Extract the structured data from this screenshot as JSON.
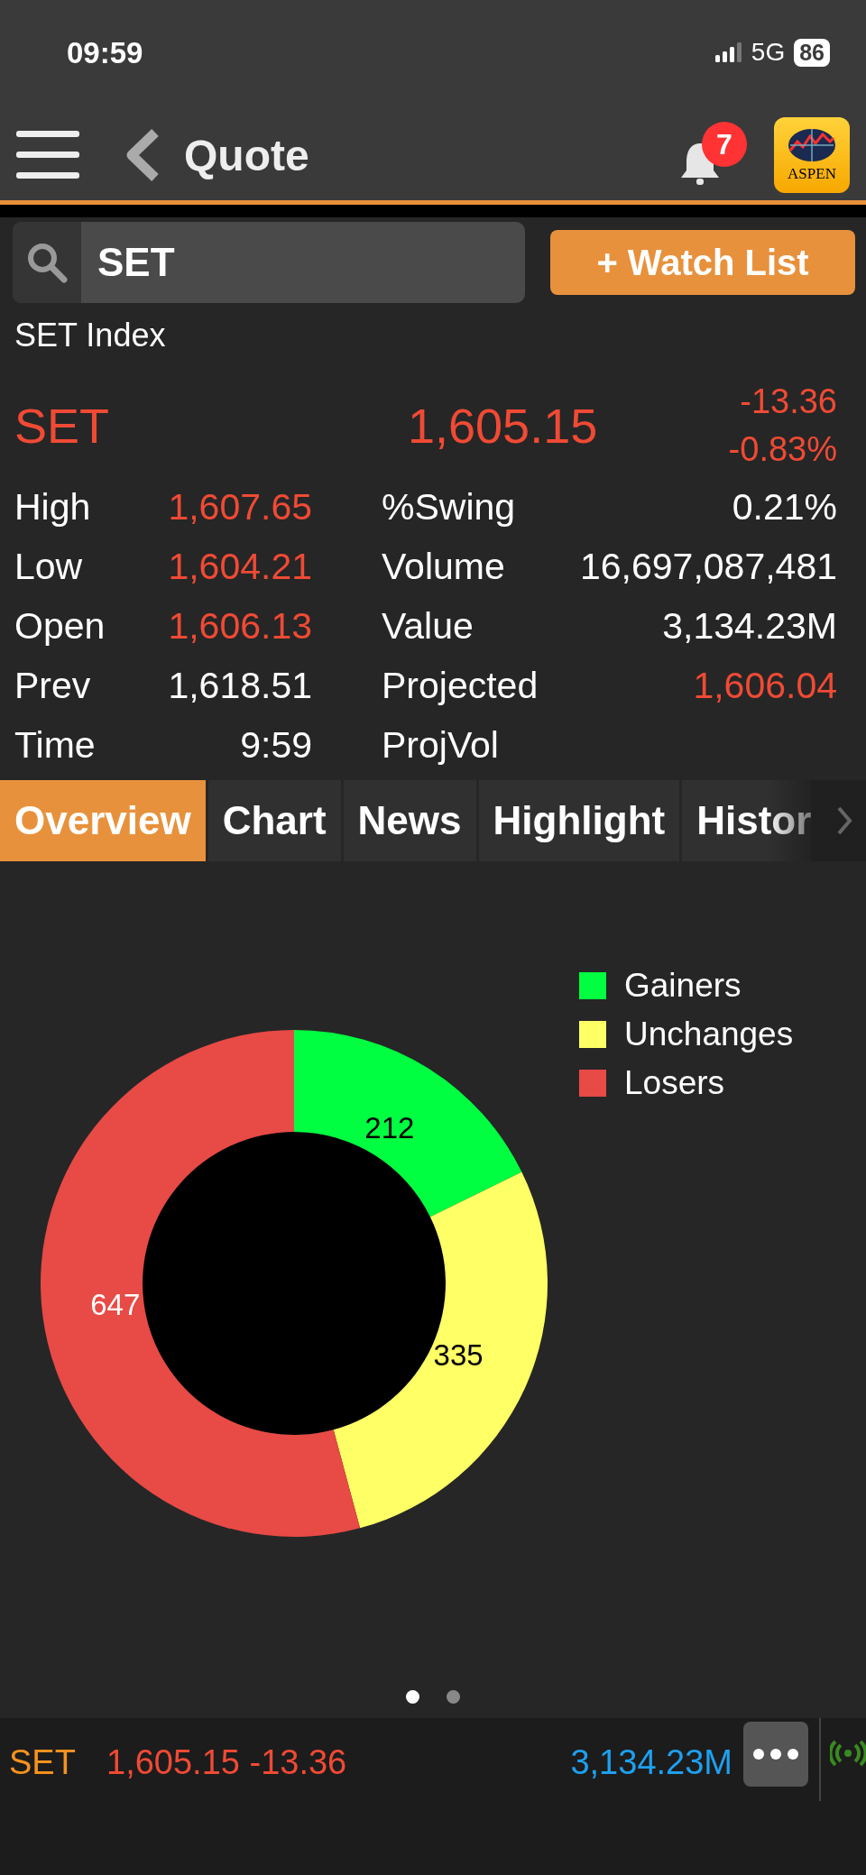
{
  "status_bar": {
    "time": "09:59",
    "network": "5G",
    "battery": "86"
  },
  "nav": {
    "title": "Quote",
    "notification_count": "7",
    "logo_text": "ASPEN"
  },
  "search": {
    "value": "SET"
  },
  "watch_button": "+ Watch List",
  "quote": {
    "name": "SET Index",
    "symbol": "SET",
    "last": "1,605.15",
    "change": "-13.36",
    "percent": "-0.83%",
    "negative": true
  },
  "stats": [
    {
      "left": {
        "label": "High",
        "value": "1,607.65",
        "negative": true
      },
      "right": {
        "label": "%Swing",
        "value": "0.21%",
        "negative": false
      }
    },
    {
      "left": {
        "label": "Low",
        "value": "1,604.21",
        "negative": true
      },
      "right": {
        "label": "Volume",
        "value": "16,697,087,481",
        "negative": false
      }
    },
    {
      "left": {
        "label": "Open",
        "value": "1,606.13",
        "negative": true
      },
      "right": {
        "label": "Value",
        "value": "3,134.23M",
        "negative": false
      }
    },
    {
      "left": {
        "label": "Prev",
        "value": "1,618.51",
        "negative": false
      },
      "right": {
        "label": "Projected",
        "value": "1,606.04",
        "negative": true
      }
    },
    {
      "left": {
        "label": "Time",
        "value": "9:59",
        "negative": false
      },
      "right": {
        "label": "ProjVol"
      }
    }
  ],
  "tabs": [
    {
      "label": "Overview",
      "selected": true
    },
    {
      "label": "Chart",
      "selected": false
    },
    {
      "label": "News",
      "selected": false
    },
    {
      "label": "Highlight",
      "selected": false
    },
    {
      "label": "Histor",
      "selected": false
    }
  ],
  "overview": {
    "chart_data": {
      "type": "donut",
      "categories": [
        "Gainers",
        "Unchanges",
        "Losers"
      ],
      "values": [
        212,
        335,
        647
      ],
      "value_labels": [
        "212",
        "335",
        "647"
      ]
    },
    "legend": [
      {
        "color": "#00ff40"
      },
      {
        "color": "#ffff66"
      },
      {
        "color": "#e84a45"
      }
    ],
    "pages": [
      {
        "selected": true
      },
      {
        "selected": false
      }
    ]
  },
  "ticker": {
    "symbol": "SET",
    "price": "1,605.15 -13.36",
    "value": "3,134.23M"
  }
}
